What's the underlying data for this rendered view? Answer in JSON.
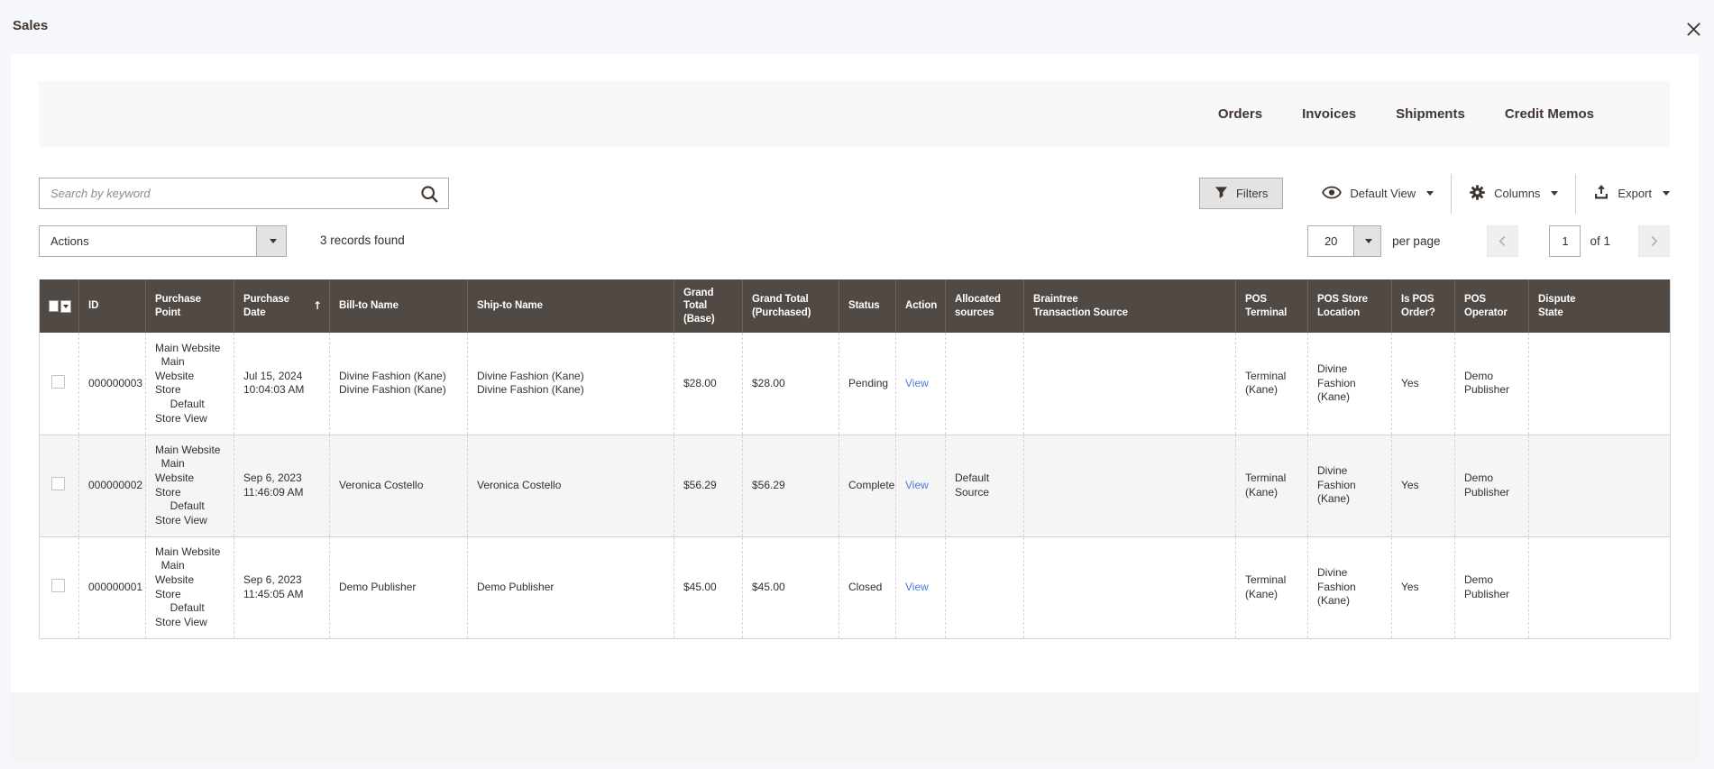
{
  "modal": {
    "title": "Sales"
  },
  "tabs": [
    {
      "label": "Orders"
    },
    {
      "label": "Invoices"
    },
    {
      "label": "Shipments"
    },
    {
      "label": "Credit Memos"
    }
  ],
  "search": {
    "placeholder": "Search by keyword"
  },
  "toolbar": {
    "filters_label": "Filters",
    "view_label": "Default View",
    "columns_label": "Columns",
    "export_label": "Export"
  },
  "actions": {
    "label": "Actions",
    "records_found": "3 records found"
  },
  "pagination": {
    "page_size": "20",
    "per_page_label": "per page",
    "current_page": "1",
    "total_label": "of 1"
  },
  "table": {
    "sort": {
      "column": "Purchase Date",
      "direction": "ascending",
      "arrow": "↑"
    },
    "columns": [
      {
        "key": "checkbox",
        "label": ""
      },
      {
        "key": "id",
        "label": "ID"
      },
      {
        "key": "purchase_point",
        "label": "Purchase Point"
      },
      {
        "key": "purchase_date",
        "label": "Purchase\nDate",
        "sorted": true
      },
      {
        "key": "bill_to",
        "label": "Bill-to Name"
      },
      {
        "key": "ship_to",
        "label": "Ship-to Name"
      },
      {
        "key": "grand_total_base",
        "label": "Grand Total\n(Base)"
      },
      {
        "key": "grand_total_purchased",
        "label": "Grand Total\n(Purchased)"
      },
      {
        "key": "status",
        "label": "Status"
      },
      {
        "key": "action",
        "label": "Action"
      },
      {
        "key": "allocated_sources",
        "label": "Allocated\nsources"
      },
      {
        "key": "braintree_transaction_source",
        "label": "Braintree\nTransaction Source"
      },
      {
        "key": "pos_terminal",
        "label": "POS\nTerminal"
      },
      {
        "key": "pos_store_location",
        "label": "POS Store\nLocation"
      },
      {
        "key": "is_pos_order",
        "label": "Is POS\nOrder?"
      },
      {
        "key": "pos_operator",
        "label": "POS\nOperator"
      },
      {
        "key": "dispute_state",
        "label": "Dispute\nState"
      }
    ],
    "rows": [
      {
        "id": "000000003",
        "purchase_point": "Main Website\n  Main Website\nStore\n     Default\nStore View",
        "purchase_date": "Jul 15, 2024\n10:04:03 AM",
        "bill_to": "Divine Fashion (Kane)\nDivine Fashion (Kane)",
        "ship_to": "Divine Fashion (Kane)\nDivine Fashion (Kane)",
        "grand_total_base": "$28.00",
        "grand_total_purchased": "$28.00",
        "status": "Pending",
        "action": "View",
        "allocated_sources": "",
        "braintree_transaction_source": "",
        "pos_terminal": "Terminal\n(Kane)",
        "pos_store_location": "Divine\nFashion\n(Kane)",
        "is_pos_order": "Yes",
        "pos_operator": "Demo\nPublisher",
        "dispute_state": ""
      },
      {
        "id": "000000002",
        "purchase_point": "Main Website\n  Main Website\nStore\n     Default\nStore View",
        "purchase_date": "Sep 6, 2023\n11:46:09 AM",
        "bill_to": "Veronica Costello",
        "ship_to": "Veronica Costello",
        "grand_total_base": "$56.29",
        "grand_total_purchased": "$56.29",
        "status": "Complete",
        "action": "View",
        "allocated_sources": "Default\nSource",
        "braintree_transaction_source": "",
        "pos_terminal": "Terminal\n(Kane)",
        "pos_store_location": "Divine\nFashion\n(Kane)",
        "is_pos_order": "Yes",
        "pos_operator": "Demo\nPublisher",
        "dispute_state": ""
      },
      {
        "id": "000000001",
        "purchase_point": "Main Website\n  Main Website\nStore\n     Default\nStore View",
        "purchase_date": "Sep 6, 2023\n11:45:05 AM",
        "bill_to": "Demo Publisher",
        "ship_to": "Demo Publisher",
        "grand_total_base": "$45.00",
        "grand_total_purchased": "$45.00",
        "status": "Closed",
        "action": "View",
        "allocated_sources": "",
        "braintree_transaction_source": "",
        "pos_terminal": "Terminal\n(Kane)",
        "pos_store_location": "Divine\nFashion\n(Kane)",
        "is_pos_order": "Yes",
        "pos_operator": "Demo\nPublisher",
        "dispute_state": ""
      }
    ]
  },
  "colors": {
    "page_bg": "#f5f7fa",
    "panel_bg": "#ffffff",
    "tabbar_bg": "#f8f8f8",
    "grid_header_bg": "#514943",
    "alt_row_bg": "#f5f5f5",
    "link": "#4c7bd9",
    "button_bg": "#e3e3e3",
    "border": "#adadad"
  }
}
